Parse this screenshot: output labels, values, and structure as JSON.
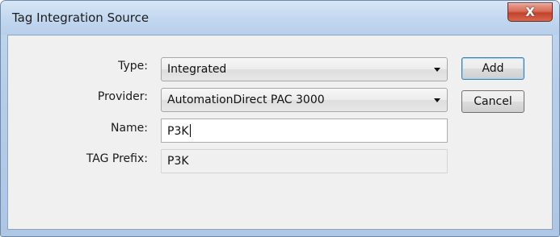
{
  "window": {
    "title": "Tag Integration Source",
    "close_label": "X"
  },
  "form": {
    "type": {
      "label": "Type:",
      "value": "Integrated"
    },
    "provider": {
      "label": "Provider:",
      "value": "AutomationDirect PAC 3000"
    },
    "name": {
      "label": "Name:",
      "value": "P3K"
    },
    "tag_prefix": {
      "label": "TAG Prefix:",
      "value": "P3K"
    }
  },
  "buttons": {
    "add": "Add",
    "cancel": "Cancel"
  }
}
